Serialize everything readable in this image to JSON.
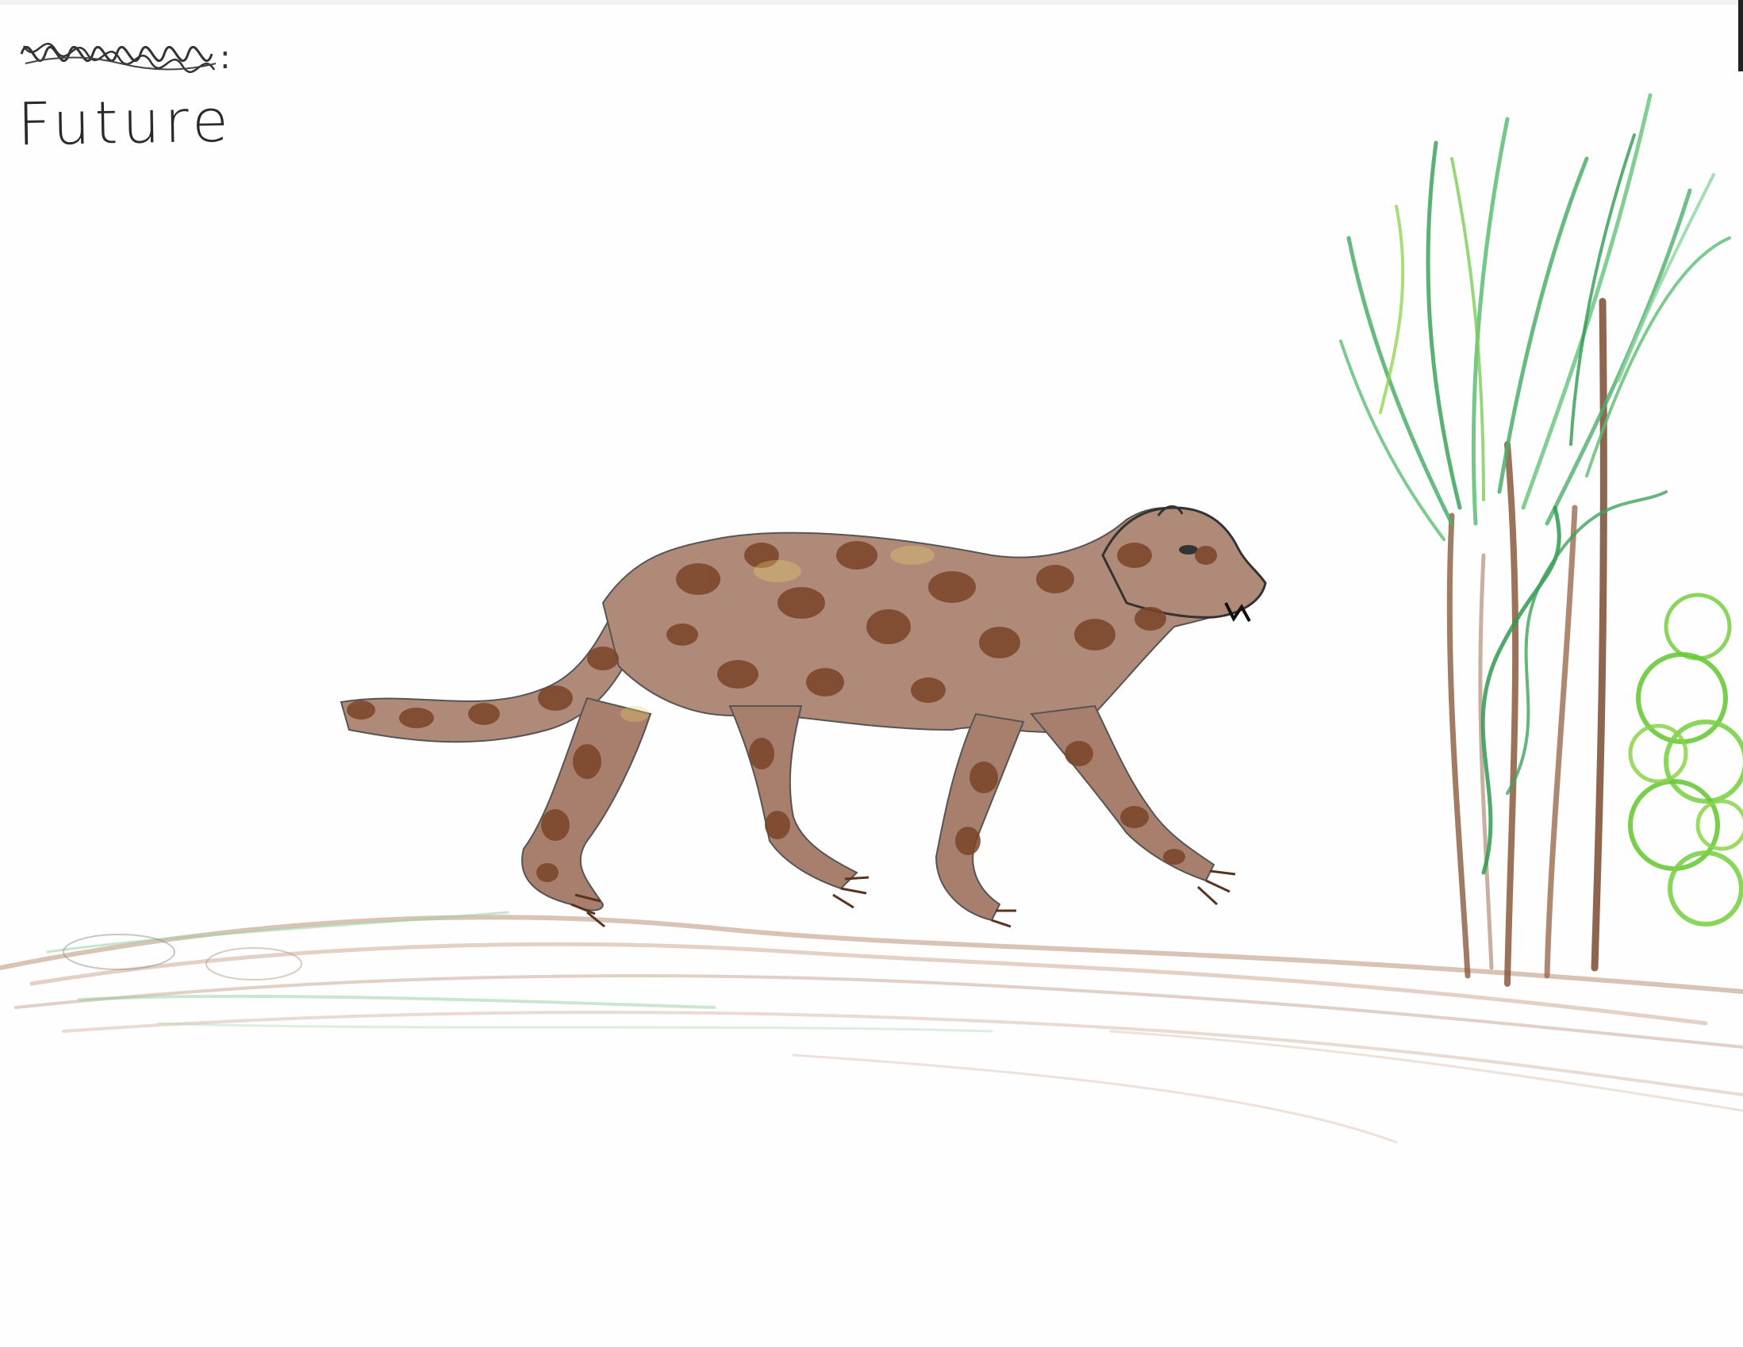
{
  "drawing": {
    "label": "Future",
    "subject": "spotted-big-cat",
    "colors": {
      "paper": "#fefefe",
      "pencil_graphite": "#2a2a2a",
      "cat_fur": "#b08a78",
      "cat_spots": "#7a4428",
      "ground_brown": "#c4a48f",
      "ground_green": "#8fc99a",
      "grass_green": "#4caf6a",
      "light_green": "#8cd34a",
      "trunk_brown": "#8a5a3c"
    }
  }
}
